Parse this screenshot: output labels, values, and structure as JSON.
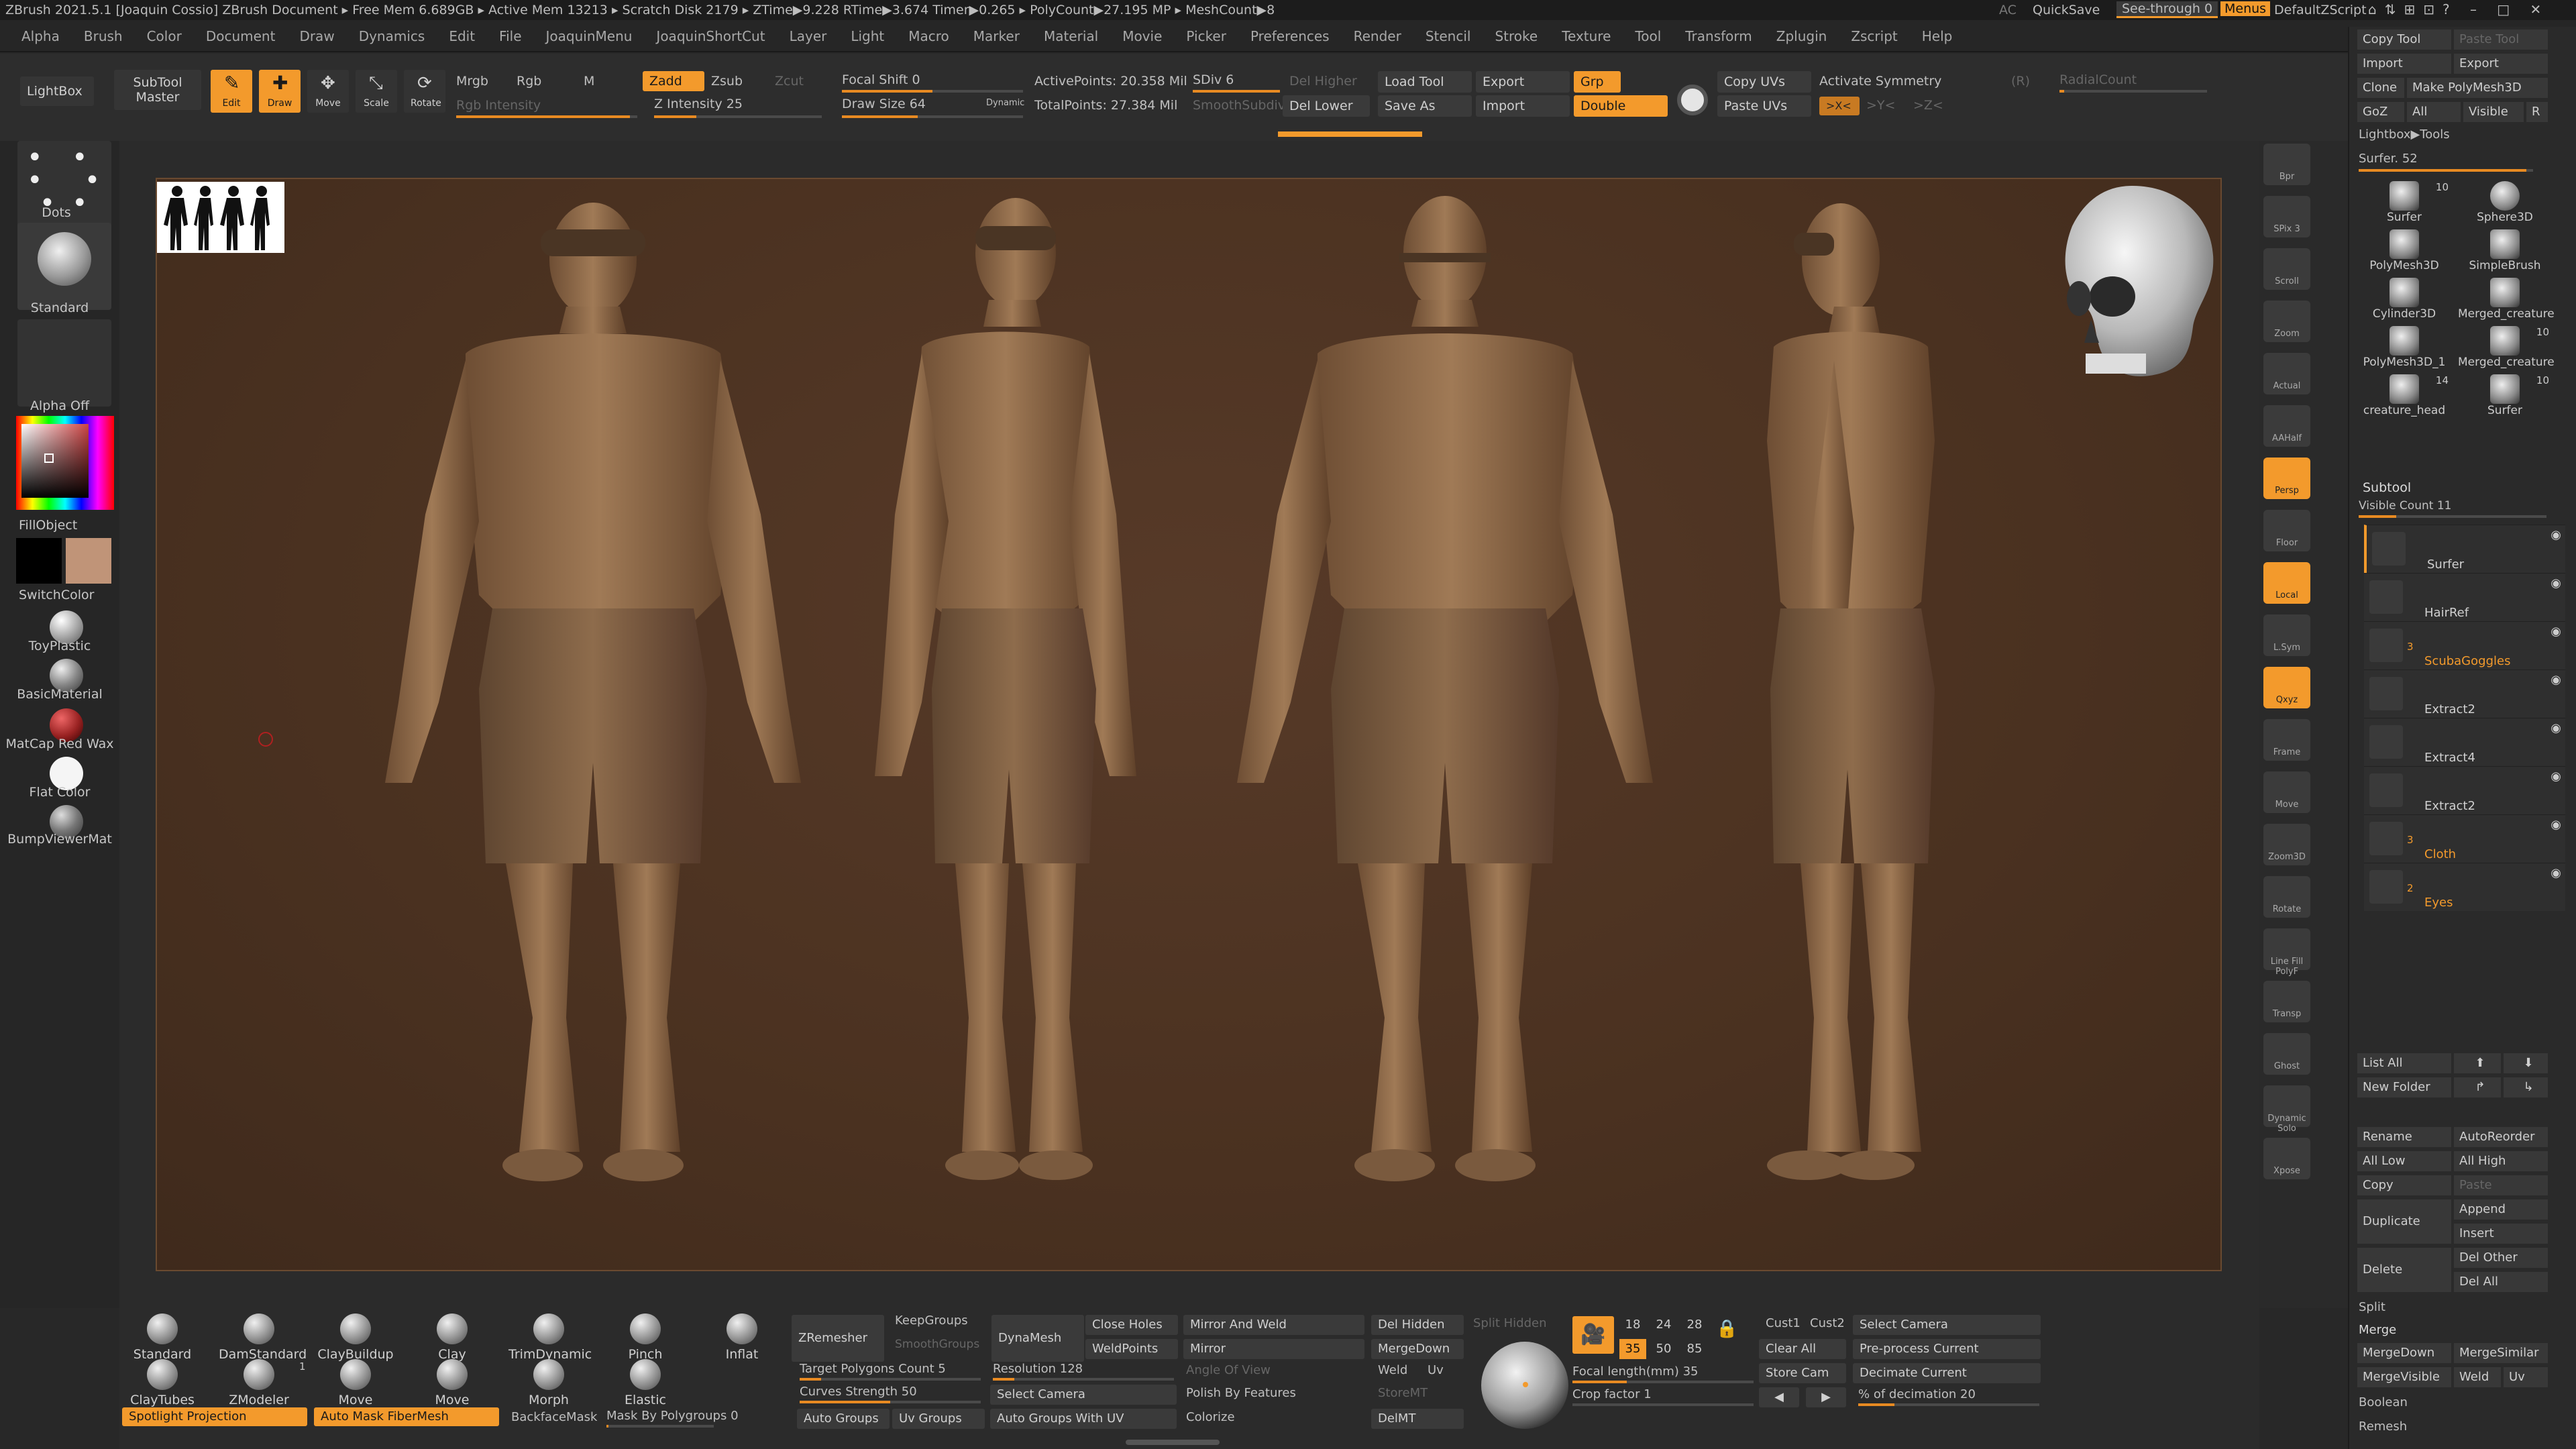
{
  "titlebar": {
    "text": "ZBrush 2021.5.1 [Joaquin Cossio]   ZBrush Document     ▸ Free Mem 6.689GB ▸ Active Mem 13213 ▸ Scratch Disk 2179 ▸ ZTime▶9.228 RTime▶3.674 Timer▶0.265 ▸ PolyCount▶27.195 MP ▸ MeshCount▶8",
    "ac": "AC",
    "quicksave": "QuickSave",
    "see_through": "See-through  0",
    "menus": "Menus",
    "default_zscript": "DefaultZScript"
  },
  "menu": [
    "Alpha",
    "Brush",
    "Color",
    "Document",
    "Draw",
    "Dynamics",
    "Edit",
    "File",
    "JoaquinMenu",
    "JoaquinShortCut",
    "Layer",
    "Light",
    "Macro",
    "Marker",
    "Material",
    "Movie",
    "Picker",
    "Preferences",
    "Render",
    "Stencil",
    "Stroke",
    "Texture",
    "Tool",
    "Transform",
    "Zplugin",
    "Zscript",
    "Help"
  ],
  "toolbar": {
    "lightbox": "LightBox",
    "subtool_master": "SubTool Master",
    "edit": "Edit",
    "draw": "Draw",
    "move": "Move",
    "scale": "Scale",
    "rotate": "Rotate",
    "mrgb": "Mrgb",
    "rgb": "Rgb",
    "m": "M",
    "rgb_intensity": "Rgb Intensity",
    "zadd": "Zadd",
    "zsub": "Zsub",
    "zcut": "Zcut",
    "z_intensity": "Z Intensity 25",
    "focal_shift": "Focal Shift 0",
    "draw_size": "Draw Size 64",
    "dynamic": "Dynamic",
    "active_points": "ActivePoints: 20.358 Mil",
    "total_points": "TotalPoints: 27.384 Mil",
    "sdiv": "SDiv 6",
    "smooth_subdiv": "SmoothSubdiv",
    "del_higher": "Del Higher",
    "del_lower": "Del Lower",
    "load_tool": "Load Tool",
    "save_as": "Save As",
    "export": "Export",
    "import": "Import",
    "grp": "Grp",
    "double": "Double",
    "copy_uvs": "Copy UVs",
    "paste_uvs": "Paste UVs",
    "activate_symmetry": "Activate Symmetry",
    "r": "(R)",
    "radial_count": "RadialCount",
    "x": ">X<",
    "y": ">Y<",
    "z": ">Z<"
  },
  "left_shelf": {
    "dots": "Dots",
    "standard": "Standard",
    "alpha_off": "Alpha Off",
    "fill_object": "FillObject",
    "switch_color": "SwitchColor",
    "materials": [
      "ToyPlastic",
      "BasicMaterial",
      "MatCap Red Wax",
      "Flat Color",
      "BumpViewerMat"
    ]
  },
  "right_shelf": [
    "Bpr",
    "SPix 3",
    "Scroll",
    "Zoom",
    "Actual",
    "AAHalf",
    "Persp",
    "Floor",
    "Local",
    "L.Sym",
    "Qxyz",
    "Frame",
    "Move",
    "Zoom3D",
    "Rotate",
    "Line Fill PolyF",
    "Transp",
    "Ghost",
    "Dynamic Solo",
    "Xpose"
  ],
  "tool_palette": {
    "copy_tool": "Copy Tool",
    "paste_tool": "Paste Tool",
    "import": "Import",
    "export": "Export",
    "clone": "Clone",
    "make_polymesh": "Make PolyMesh3D",
    "goz": "GoZ",
    "all": "All",
    "visible": "Visible",
    "r": "R",
    "lightbox_tools": "Lightbox▶Tools",
    "surfer_slider": "Surfer. 52",
    "tools": [
      {
        "name": "Surfer",
        "count": "10"
      },
      {
        "name": "Sphere3D",
        "count": ""
      },
      {
        "name": "PolyMesh3D",
        "count": ""
      },
      {
        "name": "SimpleBrush",
        "count": ""
      },
      {
        "name": "Cylinder3D",
        "count": ""
      },
      {
        "name": "Merged_creature",
        "count": ""
      },
      {
        "name": "PolyMesh3D_1",
        "count": ""
      },
      {
        "name": "Merged_creature",
        "count": "10"
      },
      {
        "name": "creature_head",
        "count": "14"
      },
      {
        "name": "Surfer",
        "count": "10"
      }
    ]
  },
  "subtool": {
    "header": "Subtool",
    "visible_count": "Visible Count 11",
    "items": [
      {
        "name": "Surfer",
        "folder": ""
      },
      {
        "name": "HairRef",
        "folder": ""
      },
      {
        "name": "ScubaGoggles",
        "folder": "3"
      },
      {
        "name": "Extract2",
        "folder": ""
      },
      {
        "name": "Extract4",
        "folder": ""
      },
      {
        "name": "Extract2",
        "folder": ""
      },
      {
        "name": "Cloth",
        "folder": "3"
      },
      {
        "name": "Eyes",
        "folder": "2"
      }
    ],
    "list_all": "List All",
    "new_folder": "New Folder",
    "rename": "Rename",
    "auto_reorder": "AutoReorder",
    "all_low": "All Low",
    "all_high": "All High",
    "copy": "Copy",
    "paste": "Paste",
    "duplicate": "Duplicate",
    "append": "Append",
    "insert": "Insert",
    "delete": "Delete",
    "del_other": "Del Other",
    "del_all": "Del All",
    "split": "Split",
    "merge": "Merge",
    "merge_down": "MergeDown",
    "merge_similar": "MergeSimilar",
    "merge_visible": "MergeVisible",
    "weld": "Weld",
    "uv": "Uv",
    "boolean": "Boolean",
    "remesh": "Remesh"
  },
  "bottom": {
    "brushes_row1": [
      "Standard",
      "DamStandard",
      "ClayBuildup",
      "Clay",
      "TrimDynamic",
      "Pinch",
      "Inflat"
    ],
    "brushes_row2": [
      "ClayTubes",
      "ZModeler",
      "Move Topologic",
      "Move",
      "Morph",
      "Elastic"
    ],
    "zmodeler_count": "1",
    "spotlight_projection": "Spotlight Projection",
    "auto_mask_fibermesh": "Auto Mask FiberMesh",
    "backface_mask": "BackfaceMask",
    "mask_by_polygroups": "Mask By Polygroups 0",
    "zremesher": "ZRemesher",
    "keep_groups": "KeepGroups",
    "smooth_groups": "SmoothGroups",
    "target_polygons": "Target Polygons Count 5",
    "curves_strength": "Curves Strength 50",
    "auto_groups": "Auto Groups",
    "uv_groups": "Uv Groups",
    "dynamesh": "DynaMesh",
    "resolution": "Resolution 128",
    "select_camera": "Select Camera",
    "auto_groups_with_uv": "Auto Groups With UV",
    "close_holes": "Close Holes",
    "weld_points": "WeldPoints",
    "angle_of_view": "Angle Of View",
    "polish_by_features": "Polish By Features",
    "colorize": "Colorize",
    "mirror_and_weld": "Mirror And Weld",
    "mirror": "Mirror",
    "weld": "Weld",
    "uv": "Uv",
    "del_hidden": "Del Hidden",
    "merge_down": "MergeDown",
    "store_mt": "StoreMT",
    "del_mt": "DelMT",
    "split_hidden": "Split Hidden",
    "lens_values": [
      "18",
      "24",
      "28",
      "35",
      "50",
      "85"
    ],
    "focal_length": "Focal length(mm) 35",
    "crop_factor": "Crop factor 1",
    "cust1": "Cust1",
    "cust2": "Cust2",
    "select_camera2": "Select Camera",
    "clear_all": "Clear All",
    "store_cam": "Store Cam",
    "pre_process_current": "Pre-process Current",
    "decimate_current": "Decimate Current",
    "pct_decimation": "% of decimation 20"
  },
  "colors": {
    "accent": "#f39a2c",
    "canvas_bg": "#4a3120",
    "skin": "#9a7552"
  }
}
